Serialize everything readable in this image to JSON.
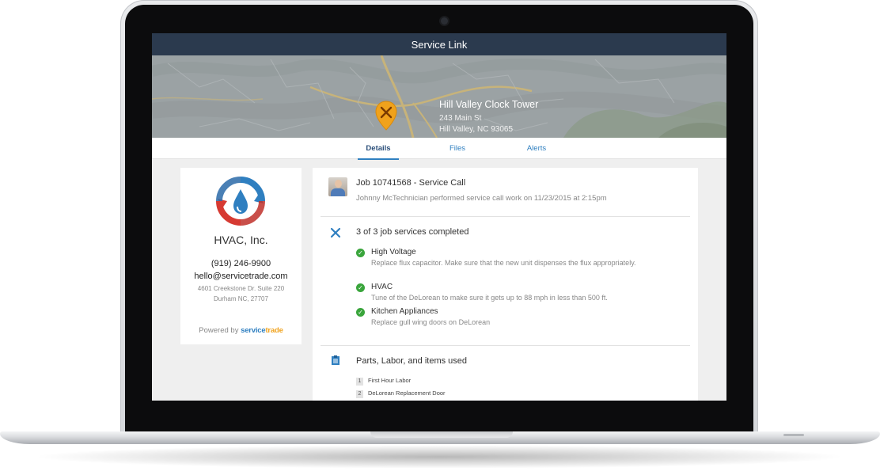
{
  "app": {
    "title": "Service Link"
  },
  "location": {
    "name": "Hill Valley Clock Tower",
    "street": "243 Main St",
    "city": "Hill Valley, NC 93065"
  },
  "tabs": [
    {
      "label": "Details",
      "active": true
    },
    {
      "label": "Files",
      "active": false
    },
    {
      "label": "Alerts",
      "active": false
    }
  ],
  "company": {
    "name": "HVAC, Inc.",
    "phone": "(919) 246-9900",
    "email": "hello@servicetrade.com",
    "address_line1": "4601 Creekstone Dr. Suite 220",
    "address_line2": "Durham NC, 27707",
    "powered_by": "Powered by",
    "brand_part1": "service",
    "brand_part2": "trade"
  },
  "job": {
    "title": "Job 10741568 - Service Call",
    "subtitle": "Johnny McTechnician performed service call work on 11/23/2015 at 2:15pm",
    "services_summary": "3 of 3 job services completed",
    "services": [
      {
        "name": "High Voltage",
        "description": "Replace flux capacitor. Make sure that the new unit dispenses the flux appropriately."
      },
      {
        "name": "HVAC",
        "description": "Tune of the DeLorean to make sure it gets up to 88 mph in less than 500 ft."
      },
      {
        "name": "Kitchen Appliances",
        "description": "Replace gull wing doors on DeLorean"
      }
    ],
    "parts_title": "Parts, Labor, and items used",
    "parts": [
      {
        "num": "1",
        "label": "First Hour Labor"
      },
      {
        "num": "2",
        "label": "DeLorean Replacement Door"
      }
    ]
  },
  "colors": {
    "titlebar": "#2b3a4e",
    "accent": "#2f7fc0",
    "success": "#3aa53c",
    "pin": "#f0a21c"
  },
  "icons": [
    "tools-pin-icon",
    "wrench-screwdriver-icon",
    "clipboard-icon",
    "check-icon",
    "camera-icon"
  ]
}
